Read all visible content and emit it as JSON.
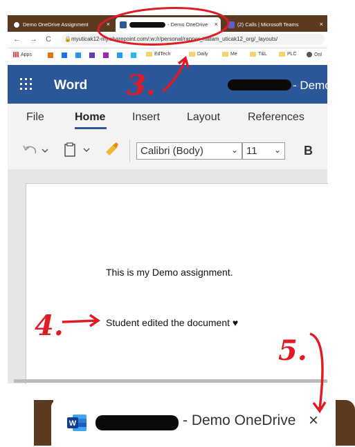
{
  "browser": {
    "tabs": [
      {
        "title": "Demo OneDrive Assignment",
        "close": "×"
      },
      {
        "title": "- Demo OneDrive",
        "close": "×"
      },
      {
        "title": "(2) Calls | Microsoft Teams",
        "close": "×"
      }
    ],
    "nav": {
      "back": "←",
      "forward": "→",
      "reload": "C"
    },
    "url": "myuticak12-my.sharepoint.com/:w:/r/personal/rapper_hallam_uticak12_org/_layouts/",
    "bookmarks": [
      "Apps",
      "EdTech",
      "Daily",
      "Me",
      "T&L",
      "PLC",
      "Onl"
    ]
  },
  "word": {
    "app_name": "Word",
    "doc_title": "- Demo",
    "tabs": [
      "File",
      "Home",
      "Insert",
      "Layout",
      "References"
    ],
    "font_name": "Calibri (Body)",
    "font_size": "11",
    "bold_label": "B",
    "doc_lines": [
      "This is my Demo assignment.",
      "Student edited the document ♥"
    ]
  },
  "zoomed_tab": {
    "title": "- Demo OneDrive",
    "close": "×"
  },
  "annotations": {
    "step3": "3.",
    "step4": "4.",
    "step5": "5."
  },
  "colors": {
    "word_blue": "#2b579a",
    "tabstrip": "#5b3a1f",
    "annotation": "#e01b24"
  }
}
